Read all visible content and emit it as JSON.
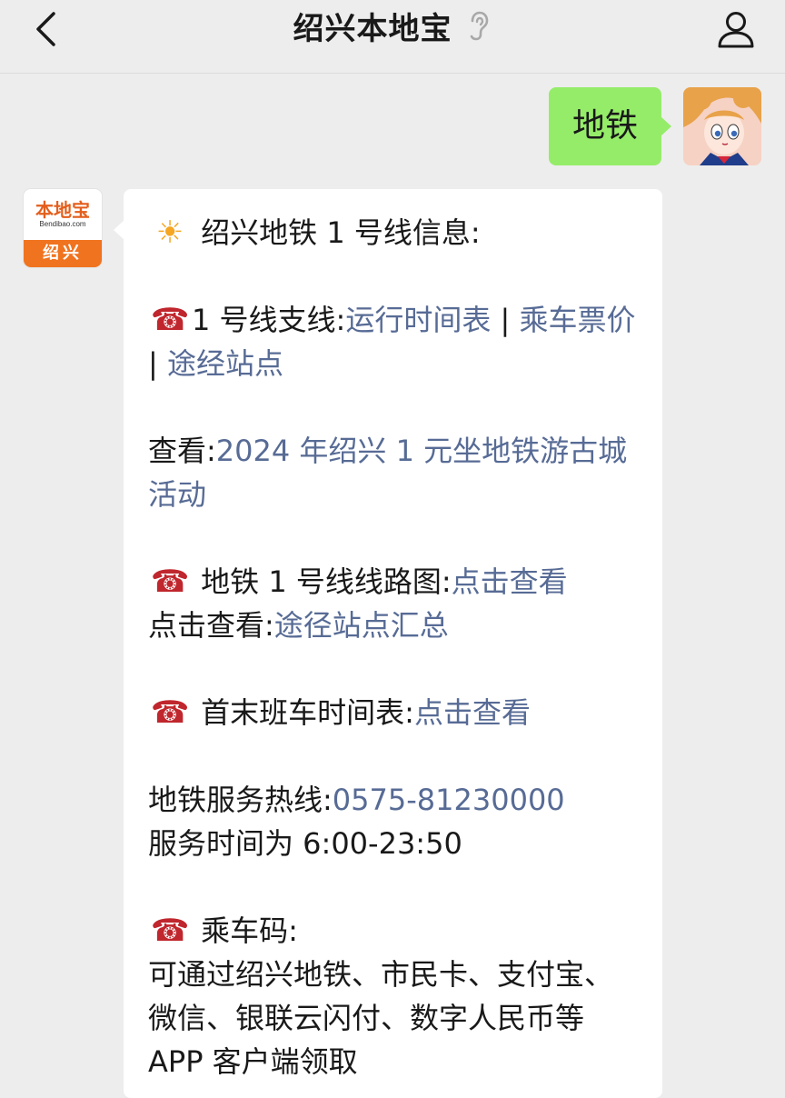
{
  "header": {
    "title": "绍兴本地宝"
  },
  "outgoing": {
    "text": "地铁"
  },
  "bot_avatar": {
    "brand": "本地宝",
    "domain": "Bendibao.com",
    "city": "绍兴"
  },
  "message": {
    "title": "绍兴地铁 1 号线信息:",
    "line_branch_label": "1 号线支线:",
    "link_schedule": "运行时间表",
    "sep": " | ",
    "link_fare": "乘车票价",
    "link_stations": "途经站点",
    "view_label": "查看:",
    "link_activity": "2024 年绍兴 1 元坐地铁游古城活动",
    "map_label": "地铁 1 号线线路图:",
    "link_click_view": "点击查看",
    "click_view_label": "点击查看:",
    "link_station_summary": "途径站点汇总",
    "first_last_label": "首末班车时间表:",
    "hotline_label": "地铁服务热线:",
    "hotline_number": "0575-81230000",
    "service_hours": "服务时间为 6:00-23:50",
    "ride_code_label": "乘车码:",
    "ride_code_text": "可通过绍兴地铁、市民卡、支付宝、微信、银联云闪付、数字人民币等 APP 客户端领取"
  },
  "icons": {
    "back": "chevron-left-icon",
    "ear": "ear-icon",
    "profile": "person-icon",
    "sun": "sun-icon",
    "phone": "telephone-icon"
  },
  "colors": {
    "background": "#ededed",
    "outgoing_bubble": "#95ec69",
    "incoming_bubble": "#ffffff",
    "link": "#576b95",
    "brand_orange": "#f0731f"
  }
}
